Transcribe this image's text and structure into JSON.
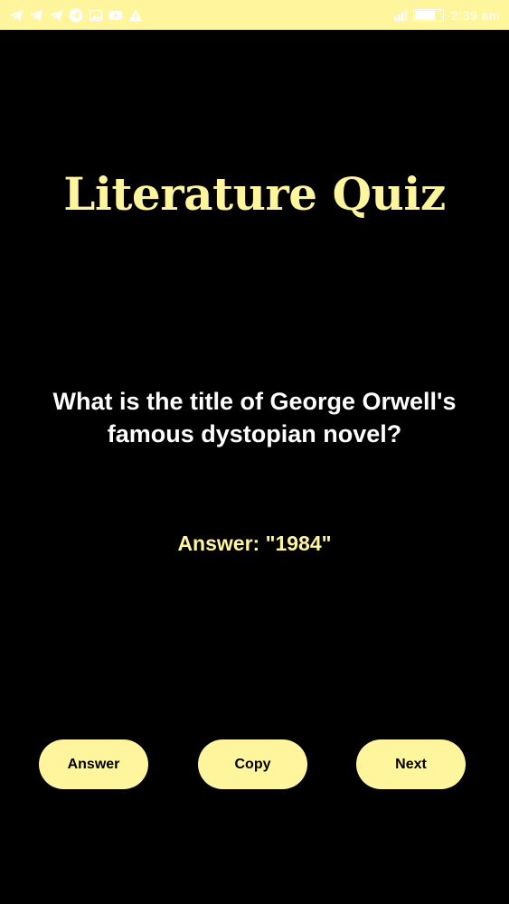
{
  "status_bar": {
    "time": "2:39 am",
    "left_icons": [
      "telegram-icon",
      "telegram-icon",
      "telegram-icon",
      "telegram-circle-icon",
      "image-icon",
      "youtube-icon",
      "warning-icon"
    ],
    "right_icons": [
      "signal-icon",
      "battery-icon"
    ]
  },
  "quiz": {
    "title": "Literature Quiz",
    "question": "What is the title of George Orwell's famous dystopian novel?",
    "answer": "Answer: \"1984\""
  },
  "buttons": {
    "answer_label": "Answer",
    "copy_label": "Copy",
    "next_label": "Next"
  },
  "colors": {
    "accent": "#FFF59D",
    "background": "#000000",
    "text": "#FFFFFF"
  }
}
